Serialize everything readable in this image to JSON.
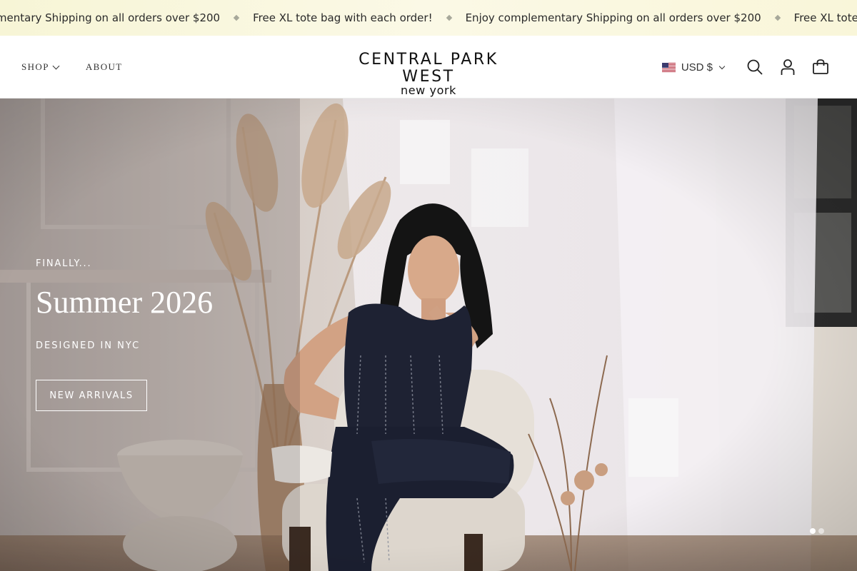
{
  "announcement": {
    "items": [
      "Enjoy complementary Shipping on all orders over $200",
      "Free XL tote bag with each order!",
      "Enjoy complementary Shipping on all orders over $200",
      "Free XL tote bag with each order!"
    ]
  },
  "header": {
    "nav": [
      {
        "label": "SHOP",
        "has_dropdown": true
      },
      {
        "label": "ABOUT",
        "has_dropdown": false
      }
    ],
    "logo": {
      "main": "CENTRAL PARK WEST",
      "sub": "new york"
    },
    "currency": {
      "label": "USD $",
      "flag_icon": "us-flag-icon"
    },
    "icons": [
      "search-icon",
      "account-icon",
      "cart-icon"
    ]
  },
  "hero": {
    "kicker": "FINALLY...",
    "title": "Summer 2026",
    "subtitle": "DESIGNED IN NYC",
    "cta_label": "NEW ARRIVALS",
    "slide_count": 2,
    "active_slide": 1
  },
  "colors": {
    "announcement_bg": "#f8f6dc",
    "text": "#222222",
    "hero_text": "#ffffff"
  }
}
